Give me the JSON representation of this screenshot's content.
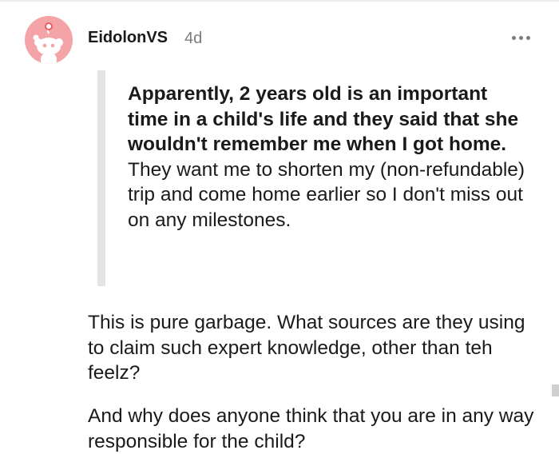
{
  "comment": {
    "author": "EidolonVS",
    "age": "4d",
    "quote": {
      "bold_text": "Apparently, 2 years old is an important time in a child's life and they said that she wouldn't remember me when I got home.",
      "regular_text": " They want me to shorten my (non-refundable) trip and come home earlier so I don't miss out on any milestones."
    },
    "paragraphs": [
      "This is pure garbage. What sources are they using to claim such expert knowledge, other than teh feelz?",
      "And why does anyone think that you are in any way responsible for the child?"
    ]
  },
  "icons": {
    "avatar": "reddit-snoo-avatar",
    "more": "more-options-icon"
  },
  "colors": {
    "avatar_bg": "#f4a3a7",
    "meta_gray": "#7c7c7c",
    "quote_bar": "#e3e3e3"
  }
}
